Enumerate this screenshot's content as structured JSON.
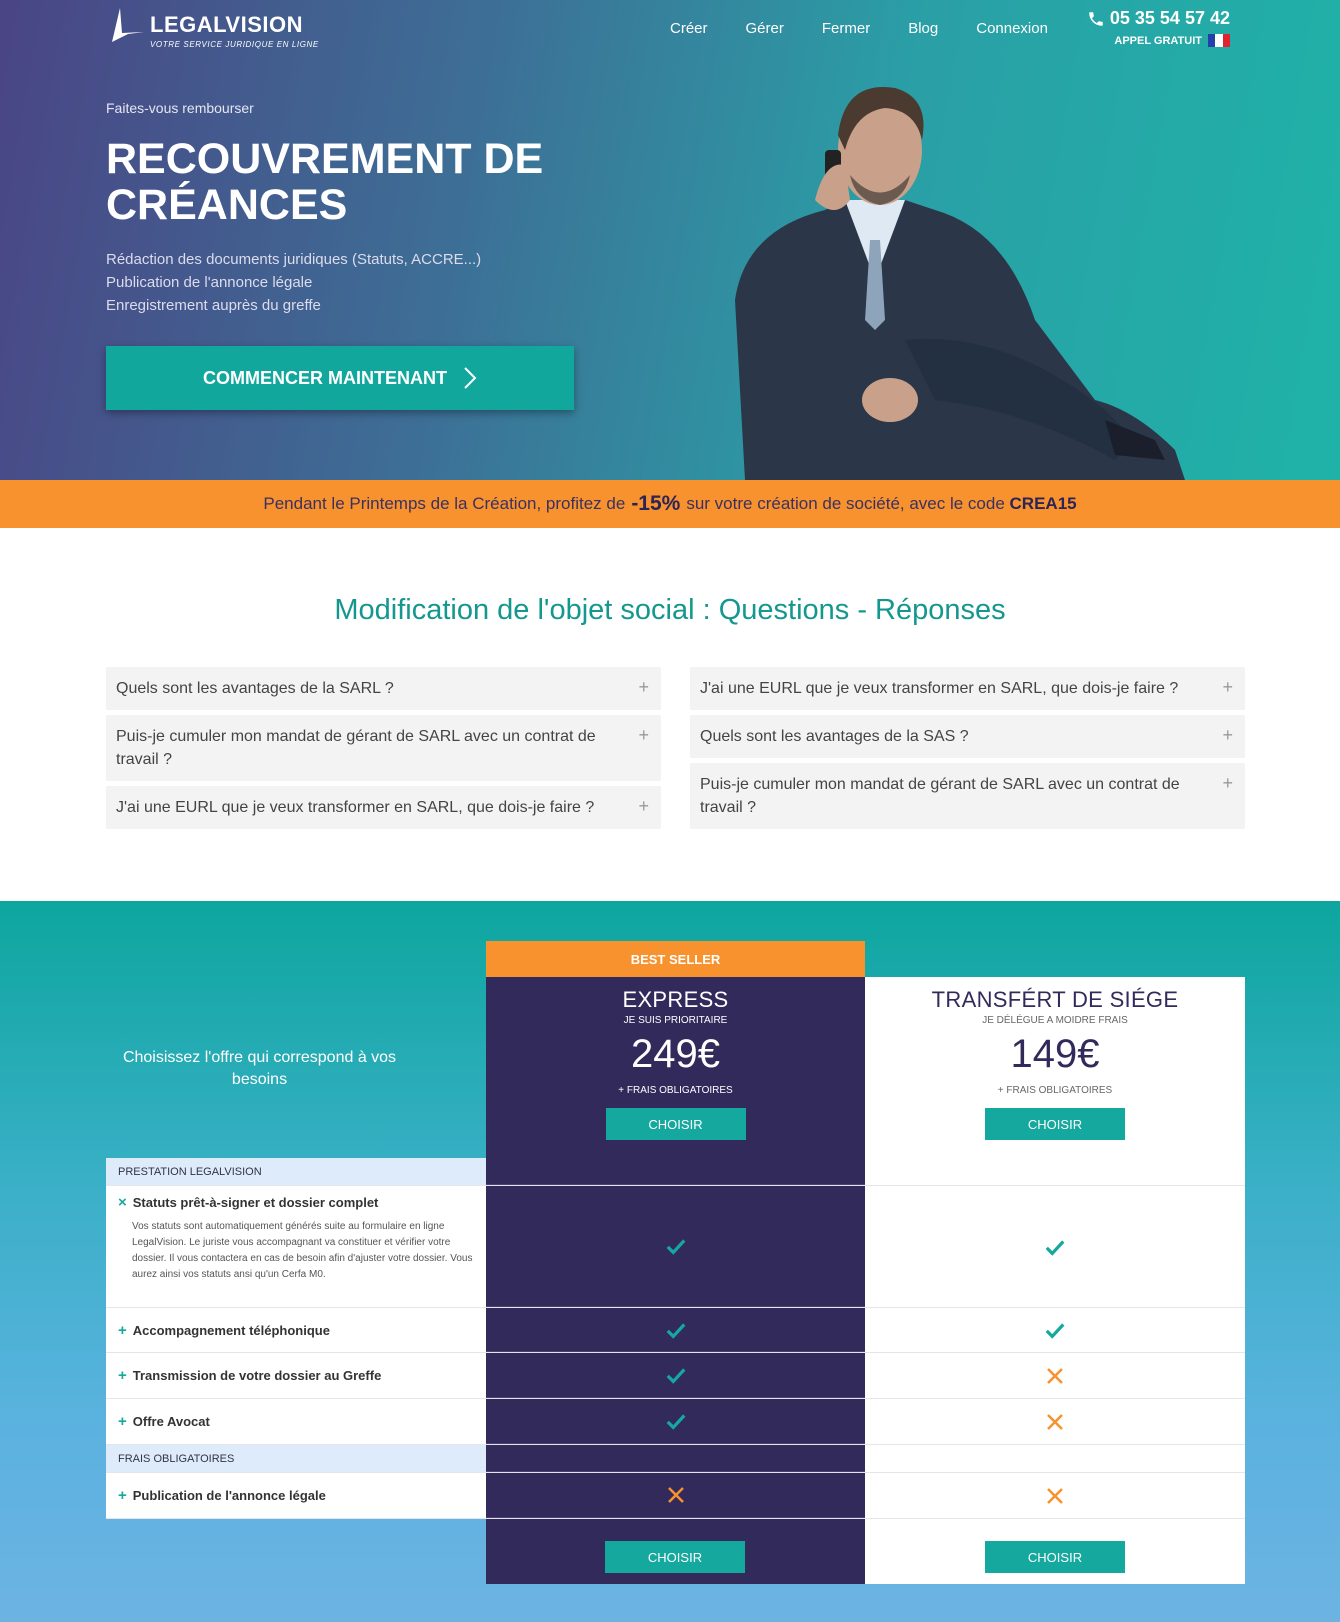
{
  "header": {
    "logo_name": "LEGALVISION",
    "logo_tagline": "VOTRE SERVICE JURIDIQUE EN LIGNE",
    "nav": [
      "Créer",
      "Gérer",
      "Fermer",
      "Blog",
      "Connexion"
    ],
    "phone": "05 35 54 57 42",
    "phone_sub": "APPEL GRATUIT"
  },
  "hero": {
    "eyebrow": "Faites-vous rembourser",
    "title_line1": "RECOUVREMENT DE",
    "title_line2": "CRÉANCES",
    "bullets": [
      "Rédaction des documents juridiques (Statuts, ACCRE...)",
      "Publication de l'annonce légale",
      "Enregistrement auprès du greffe"
    ],
    "cta": "COMMENCER MAINTENANT"
  },
  "promo": {
    "before": "Pendant le Printemps de la Création, profitez de",
    "discount": "-15%",
    "after": "sur votre création de société, avec le code",
    "code": "CREA15"
  },
  "faq": {
    "title": "Modification de l'objet social : Questions - Réponses",
    "left": [
      "Quels sont les avantages de la SARL ?",
      "Puis-je cumuler mon mandat de gérant de SARL avec un contrat de travail ?",
      "J'ai une EURL que je veux transformer en SARL, que dois-je faire ?"
    ],
    "right": [
      "J'ai une EURL que je veux transformer en SARL, que dois-je faire ?",
      "Quels sont les avantages de la SAS ?",
      "Puis-je cumuler mon mandat de gérant de SARL avec un contrat de travail ?"
    ]
  },
  "pricing": {
    "badge": "BEST SELLER",
    "intro": "Choisissez l'offre qui correspond à vos besoins",
    "express": {
      "name": "EXPRESS",
      "tag": "JE SUIS PRIORITAIRE",
      "price": "249€",
      "fee": "+ FRAIS OBLIGATOIRES",
      "button": "CHOISIR"
    },
    "transfer": {
      "name": "TRANSFÉRT DE SIÉGE",
      "tag": "JE DÉLÉGUE A MOIDRE FRAIS",
      "price": "149€",
      "fee": "+ FRAIS OBLIGATOIRES",
      "button": "CHOISIR"
    },
    "section1": "PRESTATION LEGALVISION",
    "section2": "FRAIS OBLIGATOIRES",
    "features": [
      {
        "label": "Statuts prêt-à-signer et dossier complet",
        "desc": "Vos statuts sont automatiquement générés suite au formulaire en ligne LegalVision. Le juriste vous accompagnant va constituer et vérifier votre dossier. Il vous contactera en cas de besoin afin d'ajuster votre dossier. Vous aurez ainsi vos statuts ansi qu'un Cerfa M0.",
        "express": true,
        "transfer": true
      },
      {
        "label": "Accompagnement téléphonique",
        "express": true,
        "transfer": true
      },
      {
        "label": "Transmission de votre dossier au Greffe",
        "express": true,
        "transfer": false
      },
      {
        "label": "Offre Avocat",
        "express": true,
        "transfer": false
      }
    ],
    "fees": [
      {
        "label": "Publication de l'annonce légale",
        "express": false,
        "transfer": false
      }
    ],
    "bottom_button": "CHOISIR"
  },
  "colors": {
    "teal": "#15a89e",
    "orange": "#f7922f",
    "purple": "#332a5c"
  }
}
